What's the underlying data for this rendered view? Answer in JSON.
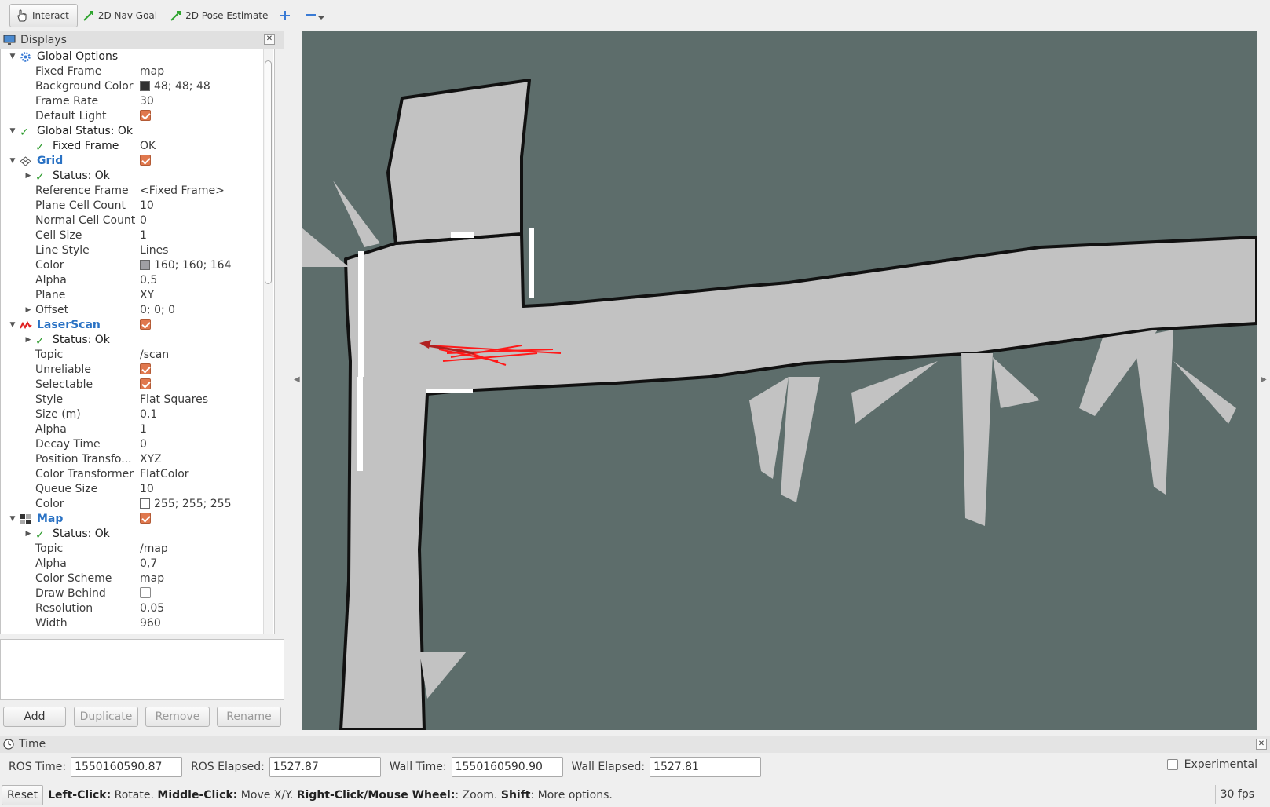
{
  "toolbar": {
    "interact": "Interact",
    "nav_goal": "2D Nav Goal",
    "pose_estimate": "2D Pose Estimate"
  },
  "displays": {
    "title": "Displays",
    "rows": [
      {
        "name": "Global Options",
        "value": ""
      },
      {
        "name": "Fixed Frame",
        "value": "map"
      },
      {
        "name": "Background Color",
        "value": "48; 48; 48"
      },
      {
        "name": "Frame Rate",
        "value": "30"
      },
      {
        "name": "Default Light",
        "value": ""
      },
      {
        "name": "Global Status: Ok",
        "value": ""
      },
      {
        "name": "Fixed Frame",
        "value": "OK"
      },
      {
        "name": "Grid",
        "value": ""
      },
      {
        "name": "Status: Ok",
        "value": ""
      },
      {
        "name": "Reference Frame",
        "value": "<Fixed Frame>"
      },
      {
        "name": "Plane Cell Count",
        "value": "10"
      },
      {
        "name": "Normal Cell Count",
        "value": "0"
      },
      {
        "name": "Cell Size",
        "value": "1"
      },
      {
        "name": "Line Style",
        "value": "Lines"
      },
      {
        "name": "Color",
        "value": "160; 160; 164"
      },
      {
        "name": "Alpha",
        "value": "0,5"
      },
      {
        "name": "Plane",
        "value": "XY"
      },
      {
        "name": "Offset",
        "value": "0; 0; 0"
      },
      {
        "name": "LaserScan",
        "value": ""
      },
      {
        "name": "Status: Ok",
        "value": ""
      },
      {
        "name": "Topic",
        "value": "/scan"
      },
      {
        "name": "Unreliable",
        "value": ""
      },
      {
        "name": "Selectable",
        "value": ""
      },
      {
        "name": "Style",
        "value": "Flat Squares"
      },
      {
        "name": "Size (m)",
        "value": "0,1"
      },
      {
        "name": "Alpha",
        "value": "1"
      },
      {
        "name": "Decay Time",
        "value": "0"
      },
      {
        "name": "Position Transfo...",
        "value": "XYZ"
      },
      {
        "name": "Color Transformer",
        "value": "FlatColor"
      },
      {
        "name": "Queue Size",
        "value": "10"
      },
      {
        "name": "Color",
        "value": "255; 255; 255"
      },
      {
        "name": "Map",
        "value": ""
      },
      {
        "name": "Status: Ok",
        "value": ""
      },
      {
        "name": "Topic",
        "value": "/map"
      },
      {
        "name": "Alpha",
        "value": "0,7"
      },
      {
        "name": "Color Scheme",
        "value": "map"
      },
      {
        "name": "Draw Behind",
        "value": ""
      },
      {
        "name": "Resolution",
        "value": "0,05"
      },
      {
        "name": "Width",
        "value": "960"
      }
    ],
    "buttons": {
      "add": "Add",
      "duplicate": "Duplicate",
      "remove": "Remove",
      "rename": "Rename"
    }
  },
  "time": {
    "title": "Time",
    "ros_time_label": "ROS Time:",
    "ros_time": "1550160590.87",
    "ros_elapsed_label": "ROS Elapsed:",
    "ros_elapsed": "1527.87",
    "wall_time_label": "Wall Time:",
    "wall_time": "1550160590.90",
    "wall_elapsed_label": "Wall Elapsed:",
    "wall_elapsed": "1527.81",
    "experimental": "Experimental"
  },
  "status": {
    "reset": "Reset",
    "left_click": "Left-Click:",
    "left_click_desc": " Rotate. ",
    "middle_click": "Middle-Click:",
    "middle_click_desc": " Move X/Y. ",
    "right_click": "Right-Click/Mouse Wheel:",
    "right_click_desc": ": Zoom. ",
    "shift": "Shift",
    "shift_desc": ": More options.",
    "fps": "30 fps"
  },
  "colors": {
    "viewport_bg": "#5d6d6b",
    "map_free": "#c2c2c2",
    "map_wall": "#111111",
    "laser": "#ff1a1a",
    "accent_blue": "#2a72c4",
    "checkbox_orange": "#e0784e"
  }
}
